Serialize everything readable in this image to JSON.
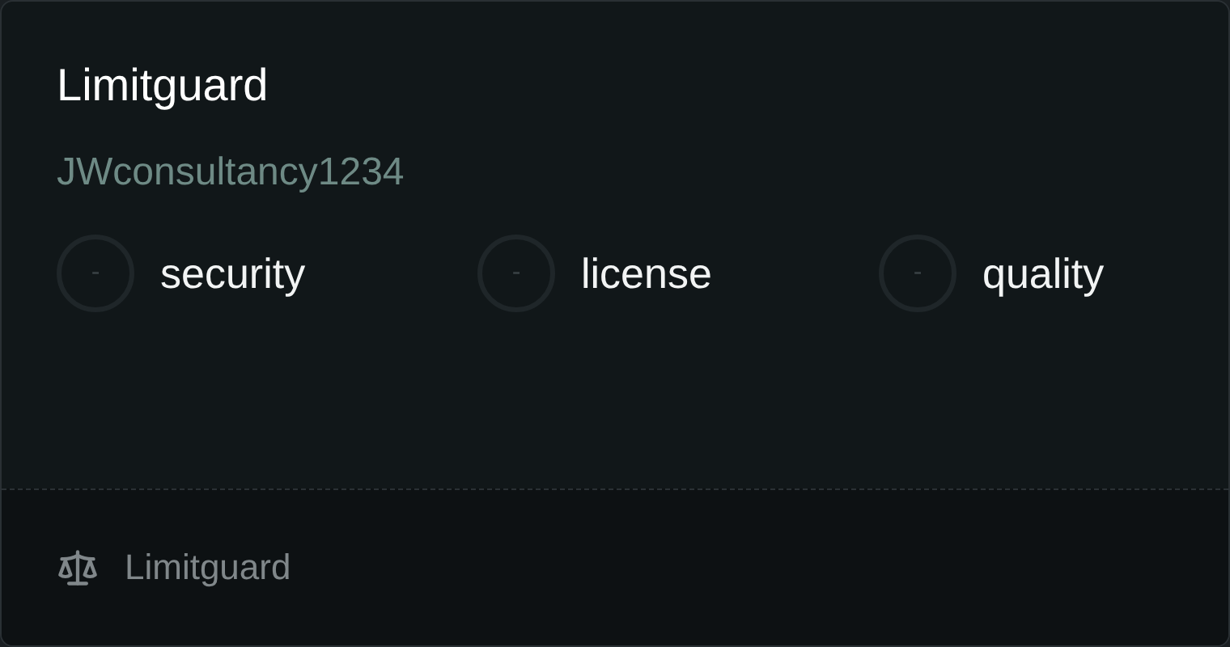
{
  "title": "Limitguard",
  "owner": "JWconsultancy1234",
  "metrics": [
    {
      "score": "-",
      "label": "security"
    },
    {
      "score": "-",
      "label": "license"
    },
    {
      "score": "-",
      "label": "quality"
    }
  ],
  "footer": {
    "license": "Limitguard"
  }
}
